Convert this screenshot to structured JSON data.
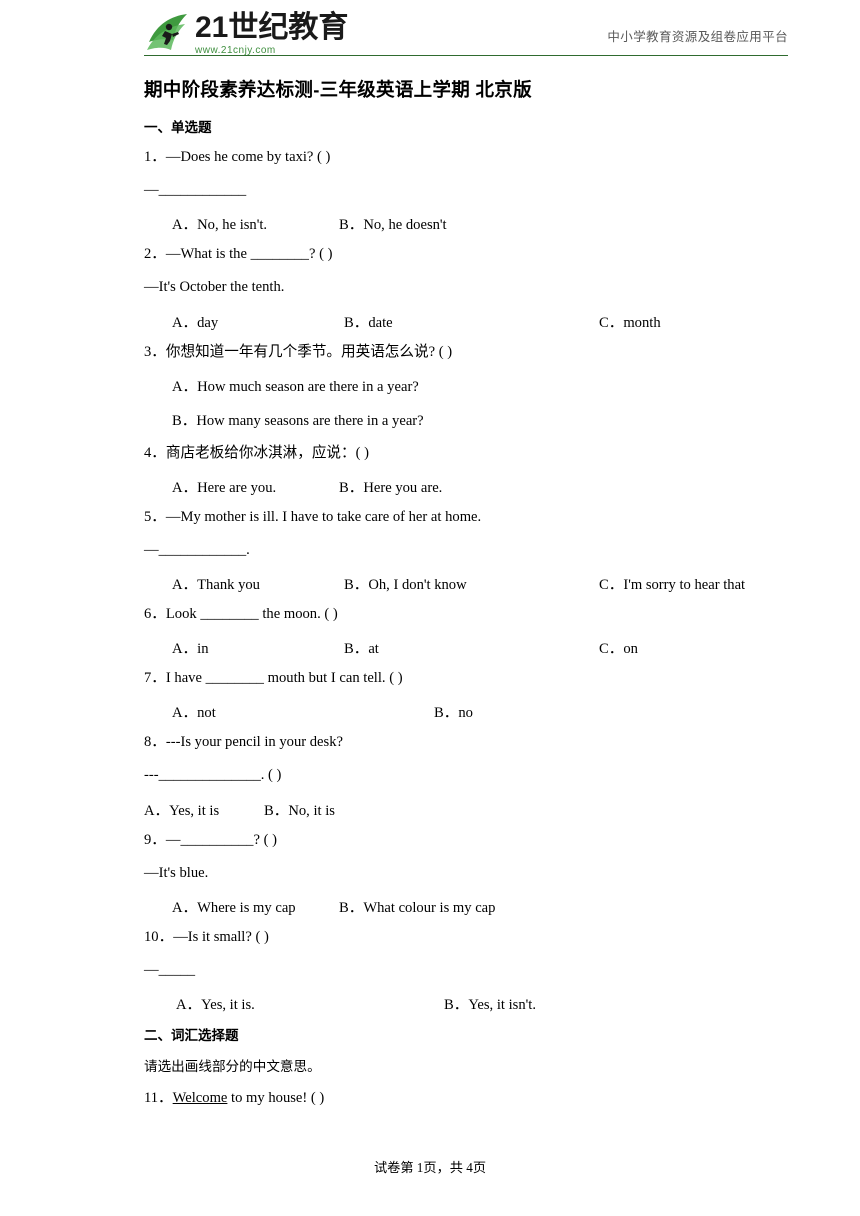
{
  "header": {
    "logo_main": "21世纪教育",
    "logo_sub": "www.21cnjy.com",
    "tagline": "中小学教育资源及组卷应用平台"
  },
  "title": "期中阶段素养达标测-三年级英语上学期 北京版",
  "sections": [
    {
      "heading": "一、单选题"
    },
    {
      "heading": "二、词汇选择题"
    }
  ],
  "questions": {
    "q1": {
      "stem": "1．—Does he come by taxi? (        )",
      "cont": "—____________",
      "opt_a": "A．No, he isn't.",
      "opt_b": "B．No, he doesn't"
    },
    "q2": {
      "stem": "2．—What is the ________?  (       )",
      "cont": "—It's October the tenth.",
      "opt_a": "A．day",
      "opt_b": "B．date",
      "opt_c": "C．month"
    },
    "q3": {
      "stem": "3．你想知道一年有几个季节。用英语怎么说? (        )",
      "opt_a": "A．How much season are there in a year?",
      "opt_b": "B．How many seasons are there in a year?"
    },
    "q4": {
      "stem": "4．商店老板给你冰淇淋，应说：(          )",
      "opt_a": "A．Here are you.",
      "opt_b": "B．Here you are."
    },
    "q5": {
      "stem": "5．—My mother is ill. I have to take care of her at home.",
      "cont": "—____________.",
      "opt_a": "A．Thank you",
      "opt_b": "B．Oh, I don't know",
      "opt_c": "C．I'm sorry to hear that"
    },
    "q6": {
      "stem": "6．Look ________ the moon. (          )",
      "opt_a": "A．in",
      "opt_b": "B．at",
      "opt_c": "C．on"
    },
    "q7": {
      "stem": "7．I have ________ mouth but I can tell. (        )",
      "opt_a": "A．not",
      "opt_b": "B．no"
    },
    "q8": {
      "stem": "8．---Is your pencil in your desk?",
      "cont": "---______________. (        )",
      "opt_a": "A．Yes, it is",
      "opt_b": "B．No, it is"
    },
    "q9": {
      "stem": "9．—__________? (        )",
      "cont": "—It's blue.",
      "opt_a": "A．Where is my cap",
      "opt_b": "B．What colour is my cap"
    },
    "q10": {
      "stem": "10．—Is it small? (         )",
      "cont": "—_____",
      "opt_a": "A．Yes, it is.",
      "opt_b": "B．Yes, it isn't."
    },
    "q11": {
      "instruction": "请选出画线部分的中文意思。",
      "stem_prefix": "11．",
      "stem_underline": "Welcome",
      "stem_suffix": " to my house! (        )"
    }
  },
  "footer": "试卷第 1页，共 4页"
}
